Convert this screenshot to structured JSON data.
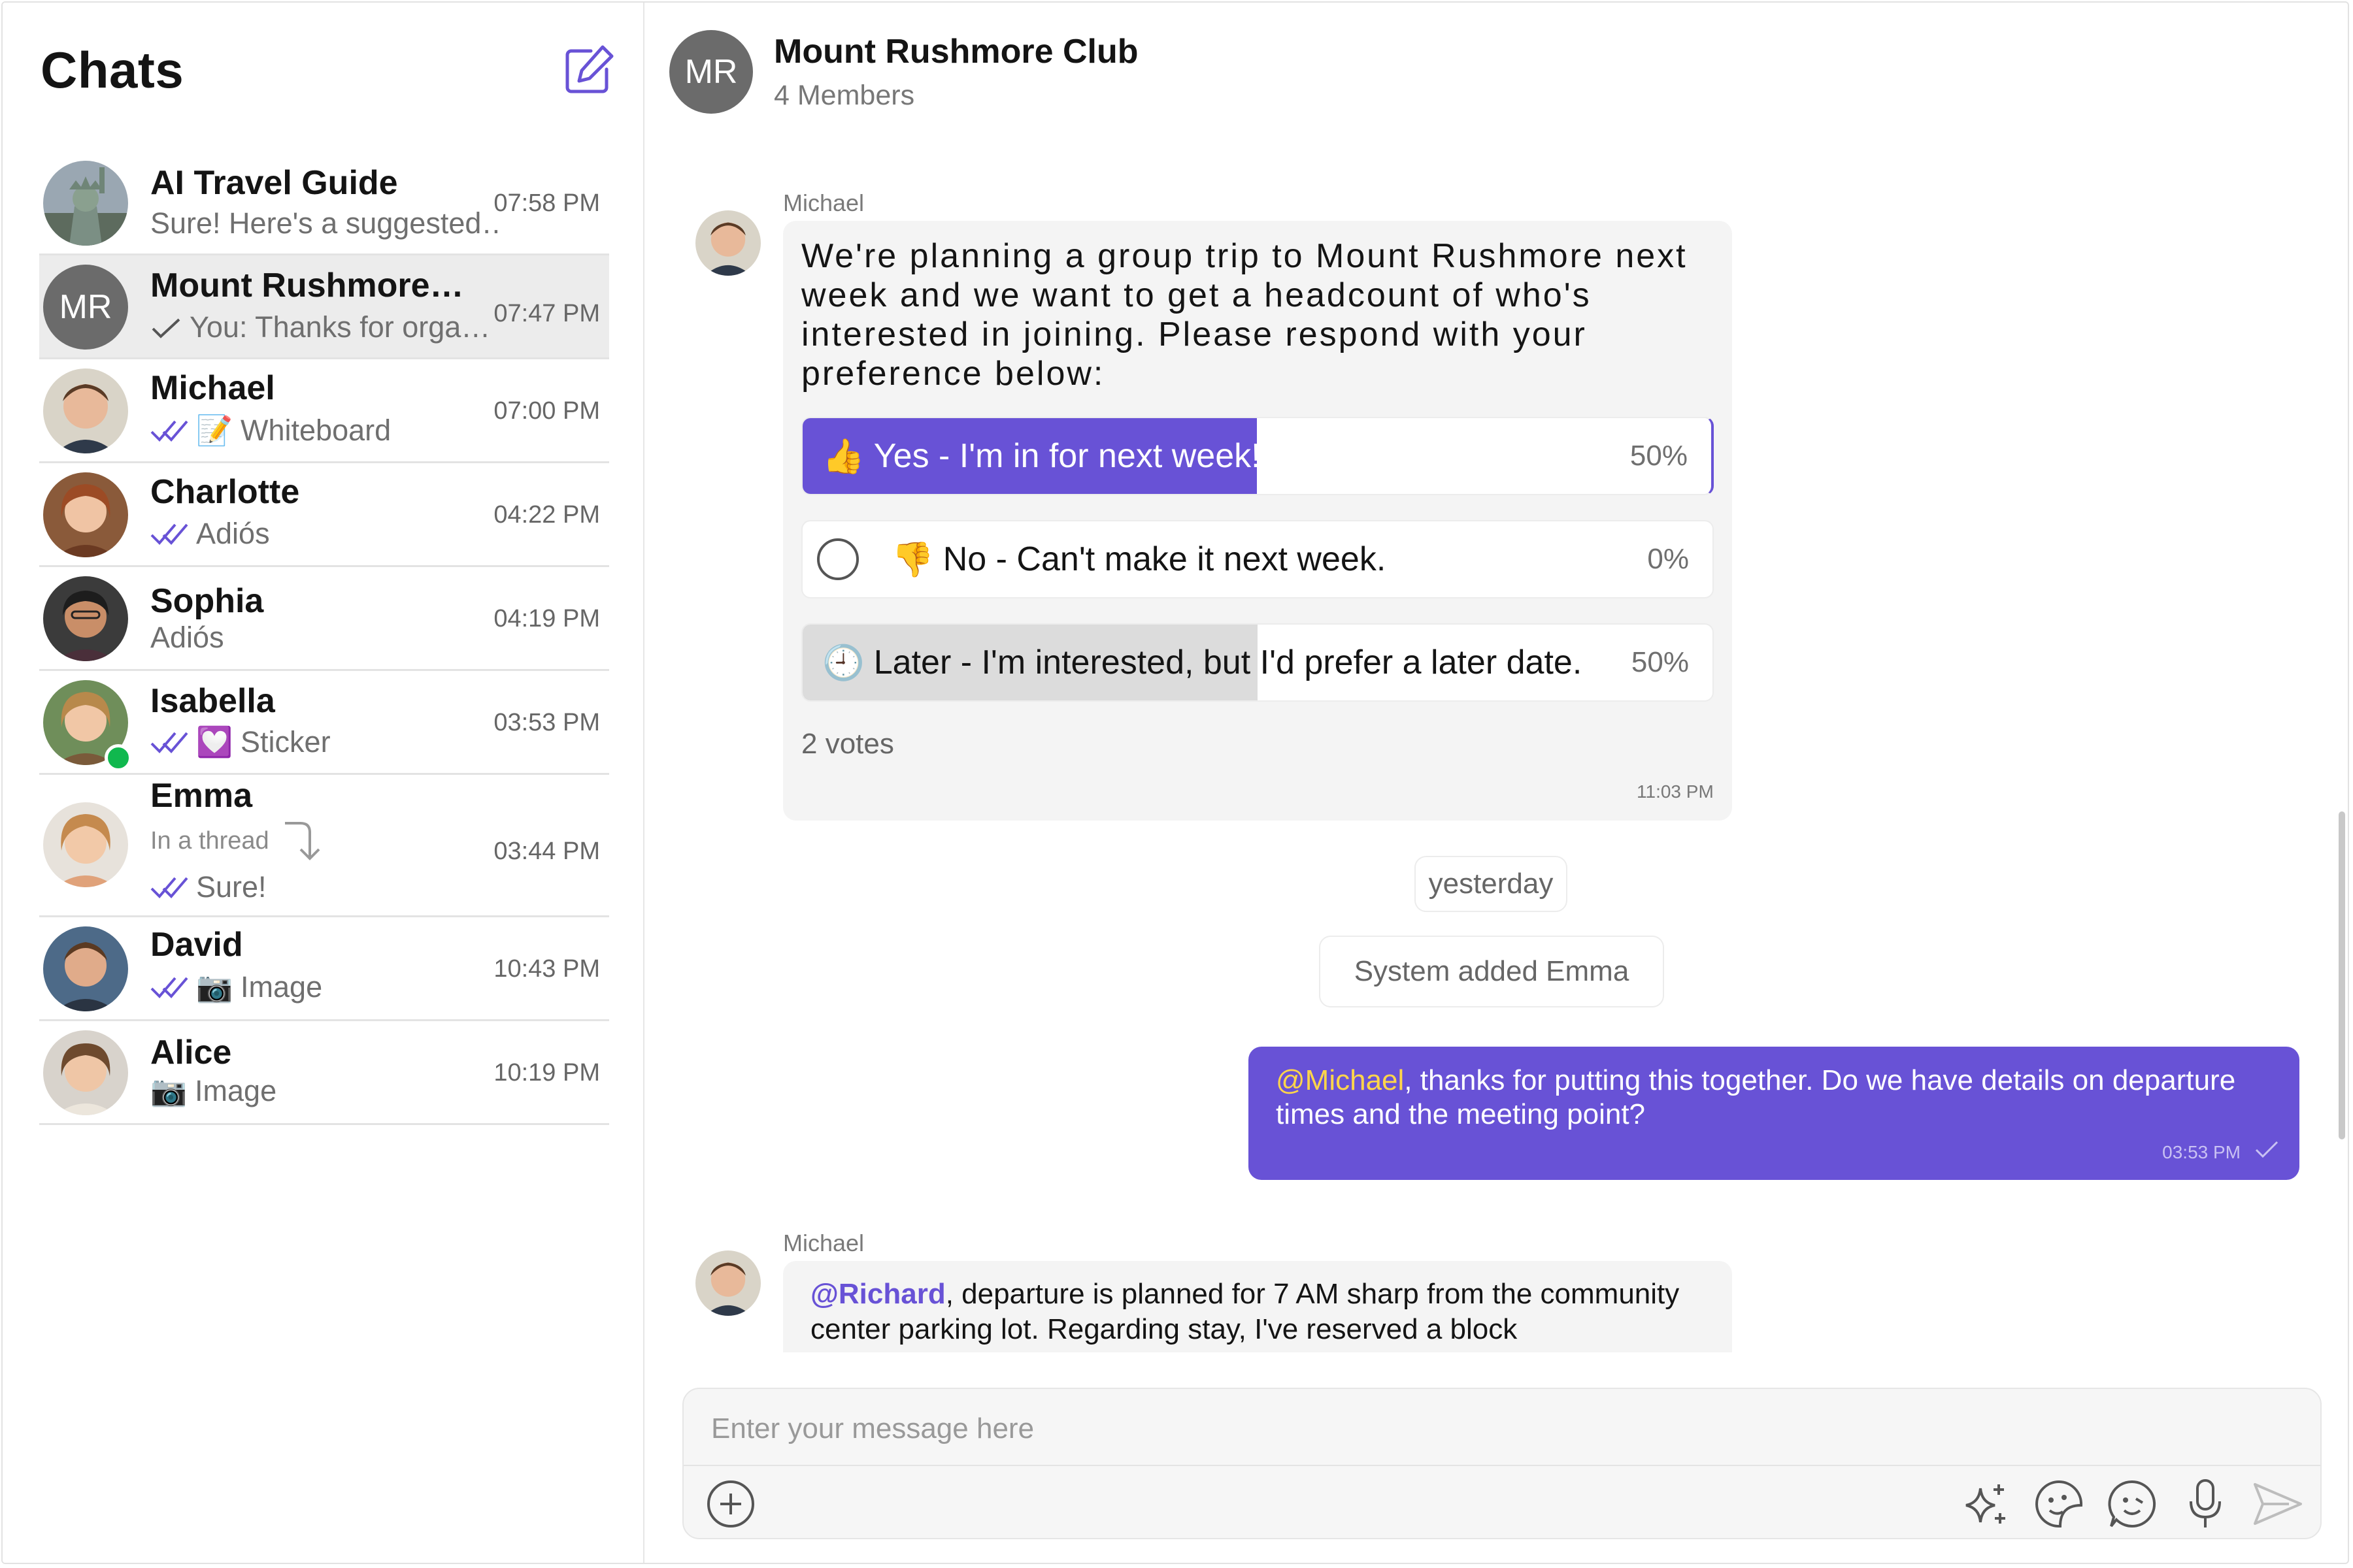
{
  "sidebar": {
    "title": "Chats",
    "compose_icon": "compose-icon",
    "chats": [
      {
        "name": "AI Travel Guide",
        "preview": "Sure! Here's a suggested…",
        "time": "07:58 PM"
      },
      {
        "name": "Mount Rushmore…",
        "avatar_initials": "MR",
        "preview": "You: Thanks for orga…",
        "time": "07:47 PM"
      },
      {
        "name": "Michael",
        "preview": "Whiteboard",
        "preview_icon": "whiteboard-icon",
        "time": "07:00 PM"
      },
      {
        "name": "Charlotte",
        "preview": "Adiós",
        "time": "04:22 PM"
      },
      {
        "name": "Sophia",
        "preview": "Adiós",
        "time": "04:19 PM"
      },
      {
        "name": "Isabella",
        "preview": "Sticker",
        "preview_icon": "sticker-icon",
        "time": "03:53 PM"
      },
      {
        "name": "Emma",
        "thread_hint": "In a thread",
        "preview": "Sure!",
        "time": "03:44 PM"
      },
      {
        "name": "David",
        "preview": "Image",
        "preview_icon": "camera-icon",
        "time": "10:43 PM"
      },
      {
        "name": "Alice",
        "preview": "Image",
        "preview_icon": "camera-icon",
        "time": "10:19 PM"
      }
    ]
  },
  "header": {
    "avatar_initials": "MR",
    "group_name": "Mount Rushmore Club",
    "members": "4 Members"
  },
  "messages": {
    "poll": {
      "author": "Michael",
      "question": "We're planning a group trip to Mount Rushmore next week and we want to get a headcount of who's interested in joining. Please respond with your preference below:",
      "options": [
        {
          "emoji": "👍",
          "label": "Yes - I'm in for next week!",
          "percent_text": "50%",
          "fraction": 0.5
        },
        {
          "emoji": "👎",
          "label": "No - Can't make it next week.",
          "percent_text": "0%",
          "fraction": 0.0
        },
        {
          "emoji": "🕘",
          "label": "Later - I'm interested, but I'd prefer a later date.",
          "percent_text": "50%",
          "fraction": 0.5
        }
      ],
      "votes": "2 votes",
      "time": "11:03 PM"
    },
    "date_separator": "yesterday",
    "system_message": "System added Emma",
    "own_message": {
      "mention": "@Michael",
      "text": ", thanks for putting this together. Do we have details on departure times and the meeting point?",
      "time": "03:53 PM"
    },
    "reply": {
      "author": "Michael",
      "mention": "@Richard",
      "text": ", departure is planned for 7 AM sharp from the community center parking lot. Regarding stay, I've reserved a block"
    }
  },
  "composer": {
    "placeholder": "Enter your message here",
    "icons": [
      "add-icon",
      "ai-sparkle-icon",
      "sticker-icon",
      "emoji-icon",
      "microphone-icon",
      "send-icon"
    ]
  },
  "colors": {
    "accent": "#6852d6",
    "mention_highlight": "#ffd54a",
    "online": "#10b84e"
  }
}
